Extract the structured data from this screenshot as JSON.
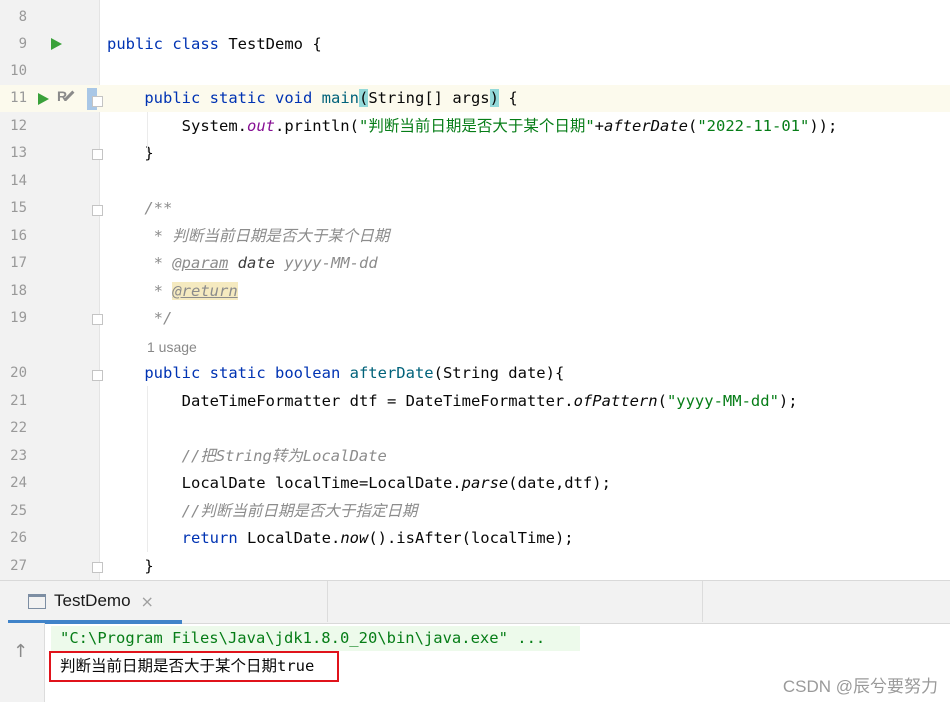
{
  "editor": {
    "current_line": "11",
    "lines": [
      {
        "num": "8",
        "parts": []
      },
      {
        "num": "9",
        "parts": [
          [
            "kw",
            "public "
          ],
          [
            "kw",
            "class "
          ],
          [
            "",
            "TestDemo {"
          ]
        ]
      },
      {
        "num": "10",
        "parts": []
      },
      {
        "num": "11",
        "parts": [
          [
            "",
            "    "
          ],
          [
            "kw",
            "public "
          ],
          [
            "kw",
            "static "
          ],
          [
            "kw",
            "void "
          ],
          [
            "fn",
            "main"
          ],
          [
            "brk",
            "("
          ],
          [
            "",
            "String[] args"
          ],
          [
            "brk",
            ")"
          ],
          [
            "",
            " {"
          ]
        ]
      },
      {
        "num": "12",
        "parts": [
          [
            "",
            "        System."
          ],
          [
            "field",
            "out"
          ],
          [
            "",
            ".println("
          ],
          [
            "str",
            "\"判断当前日期是否大于某个日期\""
          ],
          [
            "",
            "+"
          ],
          [
            "ital",
            "afterDate"
          ],
          [
            "",
            "("
          ],
          [
            "str",
            "\"2022-11-01\""
          ],
          [
            "",
            "));"
          ]
        ]
      },
      {
        "num": "13",
        "parts": [
          [
            "",
            "    }"
          ]
        ]
      },
      {
        "num": "14",
        "parts": []
      },
      {
        "num": "15",
        "parts": [
          [
            "doc",
            "    /**"
          ]
        ]
      },
      {
        "num": "16",
        "parts": [
          [
            "doc",
            "     * 判断当前日期是否大于某个日期"
          ]
        ]
      },
      {
        "num": "17",
        "parts": [
          [
            "doc",
            "     * "
          ],
          [
            "doctag",
            "@param"
          ],
          [
            "doc",
            " "
          ],
          [
            "docparam",
            "date"
          ],
          [
            "doc",
            " yyyy-MM-dd"
          ]
        ]
      },
      {
        "num": "18",
        "parts": [
          [
            "doc",
            "     * "
          ],
          [
            "doctag hl",
            "@return"
          ]
        ]
      },
      {
        "num": "19",
        "parts": [
          [
            "doc",
            "     */"
          ]
        ]
      },
      {
        "num": "20",
        "parts": [
          [
            "",
            "    "
          ],
          [
            "kw",
            "public "
          ],
          [
            "kw",
            "static "
          ],
          [
            "kw",
            "boolean "
          ],
          [
            "fn",
            "afterDate"
          ],
          [
            "",
            "(String date){"
          ]
        ]
      },
      {
        "num": "21",
        "parts": [
          [
            "",
            "        DateTimeFormatter dtf = DateTimeFormatter."
          ],
          [
            "ital",
            "ofPattern"
          ],
          [
            "",
            "("
          ],
          [
            "str",
            "\"yyyy-MM-dd\""
          ],
          [
            "",
            ");"
          ]
        ]
      },
      {
        "num": "22",
        "parts": []
      },
      {
        "num": "23",
        "parts": [
          [
            "",
            "        "
          ],
          [
            "cmt",
            "//把String转为LocalDate"
          ]
        ]
      },
      {
        "num": "24",
        "parts": [
          [
            "",
            "        LocalDate localTime=LocalDate."
          ],
          [
            "ital",
            "parse"
          ],
          [
            "",
            "(date,dtf);"
          ]
        ]
      },
      {
        "num": "25",
        "parts": [
          [
            "",
            "        "
          ],
          [
            "cmt",
            "//判断当前日期是否大于指定日期"
          ]
        ]
      },
      {
        "num": "26",
        "parts": [
          [
            "",
            "        "
          ],
          [
            "kw",
            "return "
          ],
          [
            "",
            "LocalDate."
          ],
          [
            "ital",
            "now"
          ],
          [
            "",
            "().isAfter(localTime);"
          ]
        ]
      },
      {
        "num": "27",
        "parts": [
          [
            "",
            "    }"
          ]
        ]
      }
    ],
    "usage_hint": "1 usage"
  },
  "run_panel": {
    "tab_label": "TestDemo",
    "close_glyph": "×",
    "up_glyph": "↑",
    "command": "\"C:\\Program Files\\Java\\jdk1.8.0_20\\bin\\java.exe\" ...",
    "output": "判断当前日期是否大于某个日期true"
  },
  "watermark": "CSDN @辰兮要努力",
  "colors": {
    "keyword": "#0033b3",
    "string": "#067d17",
    "method": "#00627a",
    "comment": "#8c8c8c",
    "highlight_box": "#e0131b",
    "tab_accent": "#4083c9"
  }
}
